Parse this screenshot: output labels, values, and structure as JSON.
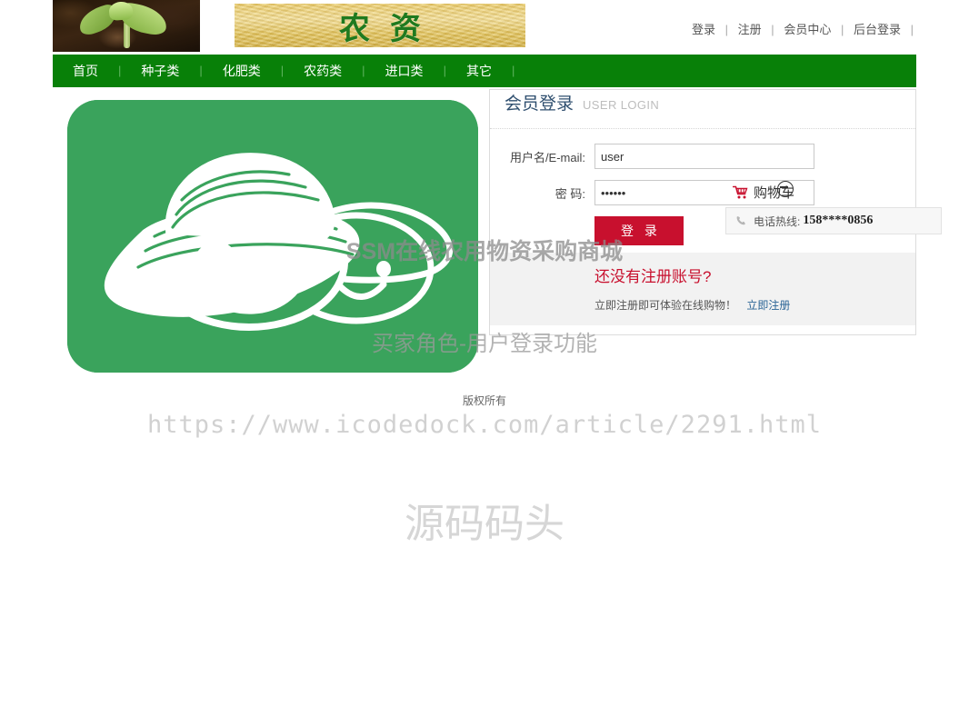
{
  "header": {
    "logo_banner_text": "农资",
    "top_links": [
      {
        "label": "登录"
      },
      {
        "label": "注册"
      },
      {
        "label": "会员中心"
      },
      {
        "label": "后台登录"
      }
    ],
    "separator": "|"
  },
  "nav": {
    "items": [
      {
        "label": "首页"
      },
      {
        "label": "种子类"
      },
      {
        "label": "化肥类"
      },
      {
        "label": "农药类"
      },
      {
        "label": "进口类"
      },
      {
        "label": "其它"
      }
    ],
    "separator": "|",
    "background_color": "#088008"
  },
  "login": {
    "title": "会员登录",
    "subtitle": "USER LOGIN",
    "username_label": "用户名/E-mail:",
    "username_value": "user",
    "username_placeholder": "",
    "password_label": "密 码:",
    "password_value": "123456",
    "password_placeholder": "",
    "submit_label": "登 录",
    "submit_color": "#c8102e",
    "register_title": "还没有注册账号?",
    "register_hint": "立即注册即可体验在线购物！",
    "register_link": "立即注册",
    "register_link_color": "#2a6496"
  },
  "floating": {
    "cart_label": "购物车",
    "cart_icon": "shopping-cart-icon",
    "hotline_label": "电话热线:",
    "hotline_number": "158****0856",
    "phone_icon": "phone-icon"
  },
  "footer": {
    "copyright": "版权所有"
  },
  "watermarks": {
    "title": "SSM在线农用物资采购商城",
    "subtitle": "买家角色-用户登录功能",
    "url": "https://www.icodedock.com/article/2291.html",
    "brand": "源码码头"
  }
}
